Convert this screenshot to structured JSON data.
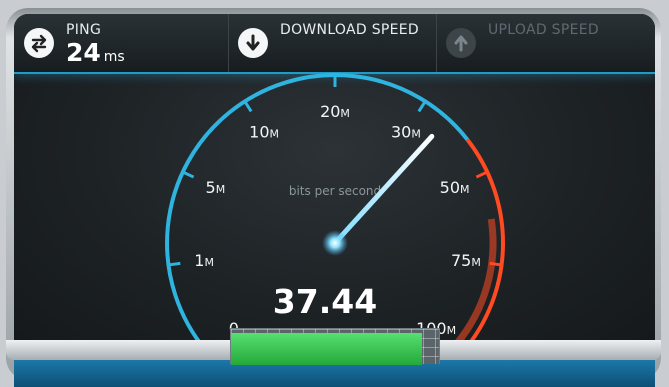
{
  "header": {
    "ping": {
      "label": "PING",
      "value": "24",
      "unit": "ms"
    },
    "download": {
      "label": "DOWNLOAD SPEED"
    },
    "upload": {
      "label": "UPLOAD SPEED"
    }
  },
  "gauge": {
    "ticks": [
      {
        "num": "0",
        "unit": ""
      },
      {
        "num": "1",
        "unit": "M"
      },
      {
        "num": "5",
        "unit": "M"
      },
      {
        "num": "10",
        "unit": "M"
      },
      {
        "num": "20",
        "unit": "M"
      },
      {
        "num": "30",
        "unit": "M"
      },
      {
        "num": "50",
        "unit": "M"
      },
      {
        "num": "75",
        "unit": "M"
      },
      {
        "num": "100",
        "unit": "M"
      }
    ],
    "center_label": "bits per second",
    "reading": "37.44",
    "needle_position": 5.3,
    "colors": {
      "arc": "#2fb3df",
      "danger": "#ff4a22",
      "needle": "#ffffff"
    }
  },
  "progress": {
    "fraction": 0.92
  }
}
